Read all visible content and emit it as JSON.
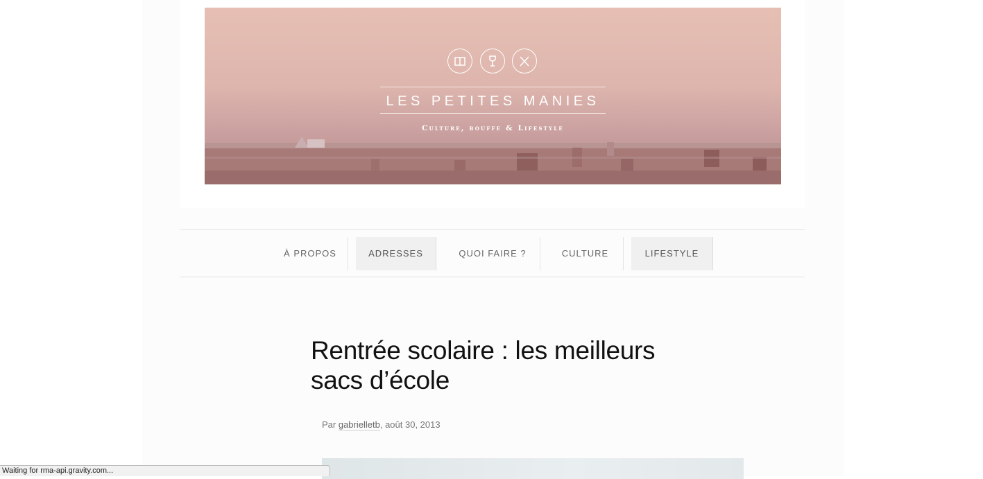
{
  "site": {
    "title": "LES PETITES MANIES",
    "tagline": "Culture, bouffe & Lifestyle",
    "emblems": [
      "book-icon",
      "wine-glass-icon",
      "utensils-icon"
    ]
  },
  "nav": {
    "items": [
      {
        "label": "À PROPOS",
        "active": false
      },
      {
        "label": "ADRESSES",
        "active": true
      },
      {
        "label": "QUOI FAIRE ?",
        "active": false
      },
      {
        "label": "CULTURE",
        "active": false
      },
      {
        "label": "LIFESTYLE",
        "active": true
      }
    ]
  },
  "post": {
    "title": "Rentrée scolaire : les meilleurs sacs d’école",
    "byline_prefix": "Par ",
    "author": "gabrielletb",
    "date": ", août 30, 2013"
  },
  "status": {
    "text": "Waiting for rma-api.gravity.com..."
  },
  "colors": {
    "banner_top": "#e6bfb4",
    "banner_bottom": "#b8888a",
    "nav_active_bg": "#f0f0f0"
  }
}
